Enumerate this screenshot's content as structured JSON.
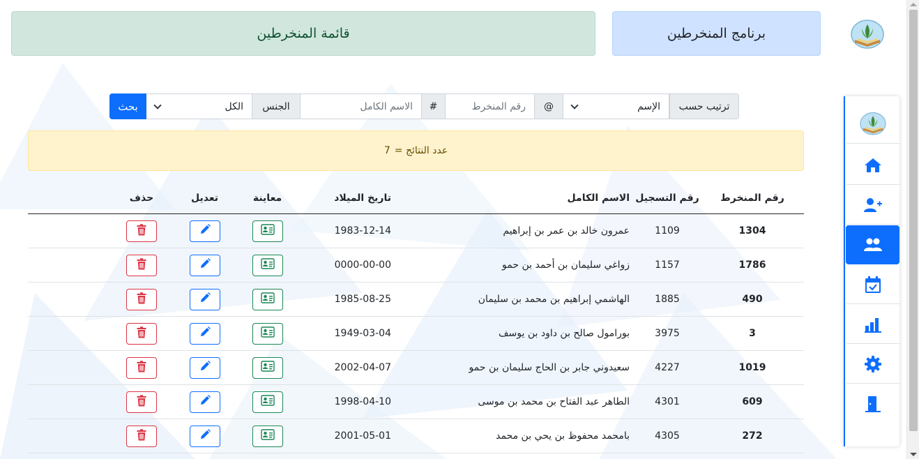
{
  "header": {
    "brand": "برنامج المنخرطين",
    "page_title": "قائمة المنخرطين"
  },
  "search": {
    "sort_label": "ترتيب حسب",
    "sort_selected": "الإسم",
    "at_symbol": "@",
    "id_placeholder": "رقم المنخرط",
    "hash_symbol": "#",
    "name_placeholder": "الاسم الكامل",
    "gender_label": "الجنس",
    "gender_selected": "الكل",
    "search_button": "بحث"
  },
  "results": {
    "label": "عدد النتائج =",
    "count": "7"
  },
  "table": {
    "headers": {
      "id": "رقم المنخرط",
      "reg": "رقم التسجيل",
      "name": "الاسم الكامل",
      "birth": "تاريخ الميلاد",
      "view": "معاينة",
      "edit": "تعديل",
      "delete": "حذف"
    },
    "rows": [
      {
        "id": "1304",
        "reg": "1109",
        "name": "عمرون خالد بن عمر بن إبراهيم",
        "birth": "1983-12-14"
      },
      {
        "id": "1786",
        "reg": "1157",
        "name": "زواغي سليمان بن أحمد بن حمو",
        "birth": "0000-00-00"
      },
      {
        "id": "490",
        "reg": "1885",
        "name": "الهاشمي إبراهيم بن محمد بن سليمان",
        "birth": "1985-08-25"
      },
      {
        "id": "3",
        "reg": "3975",
        "name": "بورامول صالح بن داود بن يوسف",
        "birth": "1949-03-04"
      },
      {
        "id": "1019",
        "reg": "4227",
        "name": "سعيدوني جابر بن الحاج سليمان بن حمو",
        "birth": "2002-04-07"
      },
      {
        "id": "609",
        "reg": "4301",
        "name": "الطاهر عبد الفتاح بن محمد بن موسى",
        "birth": "1998-04-10"
      },
      {
        "id": "272",
        "reg": "4305",
        "name": "بامحمد محفوظ بن يحي بن محمد",
        "birth": "2001-05-01"
      }
    ]
  },
  "sidebar": {
    "items": [
      {
        "icon": "logo-icon"
      },
      {
        "icon": "home-icon"
      },
      {
        "icon": "user-plus-icon"
      },
      {
        "icon": "users-icon",
        "active": true
      },
      {
        "icon": "calendar-check-icon"
      },
      {
        "icon": "bar-chart-icon"
      },
      {
        "icon": "gear-icon"
      },
      {
        "icon": "door-exit-icon"
      }
    ]
  },
  "colors": {
    "primary": "#0d6efd",
    "success": "#198754",
    "danger": "#dc3545",
    "brand_bg": "#cfe2ff",
    "title_bg": "#d1e7dd",
    "alert_bg": "#fff3cd"
  }
}
